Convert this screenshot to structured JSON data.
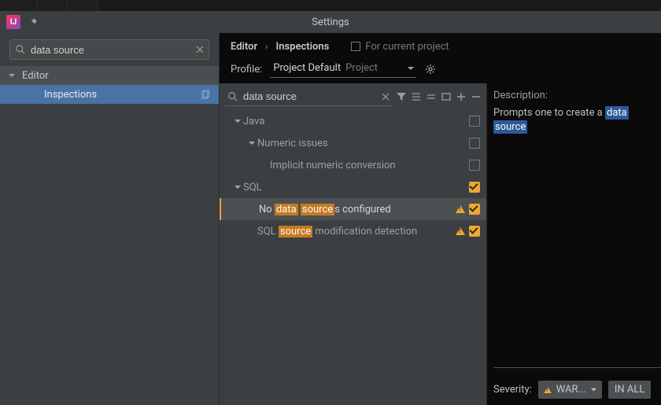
{
  "title": "Settings",
  "sidebar": {
    "search": "data source",
    "group": "Editor",
    "item": "Inspections"
  },
  "breadcrumb": {
    "a": "Editor",
    "b": "Inspections",
    "project": "For current project"
  },
  "profile": {
    "label": "Profile:",
    "value": "Project Default",
    "suffix": "Project"
  },
  "tree": {
    "search": "data source",
    "java": {
      "label": "Java"
    },
    "numeric": {
      "label": "Numeric issues"
    },
    "implicit": {
      "label": "Implicit numeric conversion"
    },
    "sql": {
      "label": "SQL"
    },
    "no_ds": {
      "pre": "No ",
      "h1": "data",
      "sp": " ",
      "h2": "source",
      "post": "s configured"
    },
    "sql_src": {
      "pre": "SQL ",
      "h": "source",
      "post": " modification detection"
    }
  },
  "desc": {
    "label": "Description:",
    "pre": "Prompts one to create a ",
    "h1": "data",
    "sp": " ",
    "h2": "source"
  },
  "severity": {
    "label": "Severity:",
    "value": "WAR...",
    "scope": "IN ALL"
  }
}
